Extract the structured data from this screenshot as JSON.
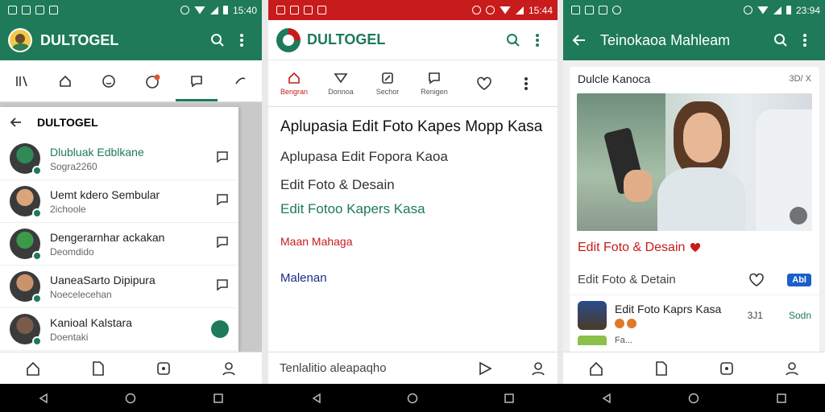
{
  "phone1": {
    "status": {
      "time": "15:40"
    },
    "app_title": "DULTOGEL",
    "drawer_title": "DULTOGEL",
    "chats": [
      {
        "name": "Dlubluak Edblkane",
        "sub": "Sogra2260",
        "highlight": true
      },
      {
        "name": "Uemt kdero Sembular",
        "sub": "2ichoole",
        "highlight": false
      },
      {
        "name": "Dengerarnhar ackakan",
        "sub": "Deomdido",
        "highlight": false
      },
      {
        "name": "UaneaSarto Dipipura",
        "sub": "Noecelecehan",
        "highlight": false
      },
      {
        "name": "Kanioal Kalstara",
        "sub": "Doentaki",
        "highlight": false
      }
    ]
  },
  "phone2": {
    "status": {
      "time": "15:44"
    },
    "app_title": "DULTOGEL",
    "tabs": [
      "Bengran",
      "Donnoa",
      "Sechor",
      "Renigen"
    ],
    "headline": "Aplupasia Edit Foto Kapes Mopp Kasa",
    "items": [
      "Aplupasa Edit Fopora Kaoa",
      "Edit Foto & Desain",
      "Edit Fotoo Kapers Kasa"
    ],
    "link_red": "Maan Mahaga",
    "link_blue": "Malenan",
    "search_placeholder": "Tenlalitio aleapaqho"
  },
  "phone3": {
    "status": {
      "time": "23:94"
    },
    "app_title": "Teinokaoa Mahleam",
    "card_title": "Dulcle Kanoca",
    "card_count": "3D/ X",
    "caption_red": "Edit Foto & Desain",
    "row_label": "Edit Foto & Detain",
    "row_tag": "Abl",
    "list_item_title": "Edit Foto Kaprs Kasa",
    "list_item_num": "3J1",
    "list_item_action": "Sodn",
    "partial_row": "Fa..."
  },
  "colors": {
    "green": "#1e7a58",
    "red": "#c81b1b",
    "blue": "#1a2b8a"
  }
}
